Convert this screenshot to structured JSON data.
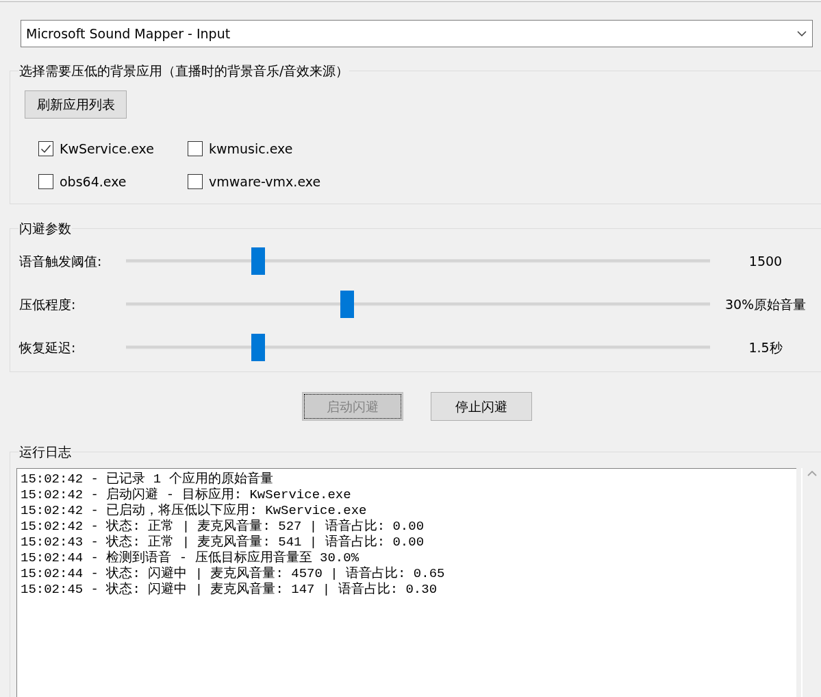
{
  "device_dropdown": {
    "value": "Microsoft Sound Mapper - Input"
  },
  "app_group": {
    "title": "选择需要压低的背景应用（直播时的背景音乐/音效来源）",
    "refresh_button": "刷新应用列表",
    "apps": [
      {
        "label": "KwService.exe",
        "checked": true
      },
      {
        "label": "kwmusic.exe",
        "checked": false
      },
      {
        "label": "obs64.exe",
        "checked": false
      },
      {
        "label": "vmware-vmx.exe",
        "checked": false
      }
    ]
  },
  "ducking_group": {
    "title": "闪避参数",
    "sliders": [
      {
        "label": "语音触发阈值:",
        "level": 0.22,
        "reading": "1500"
      },
      {
        "label": "压低程度:",
        "level": 0.376,
        "reading": "30%原始音量"
      },
      {
        "label": "恢复延迟:",
        "level": 0.22,
        "reading": "1.5秒"
      }
    ]
  },
  "buttons": [
    {
      "label": "启动闪避",
      "disabled": true,
      "focused": true
    },
    {
      "label": "停止闪避",
      "disabled": false,
      "focused": false
    }
  ],
  "log_group": {
    "title": "运行日志",
    "lines": [
      "15:02:42 - 已记录 1 个应用的原始音量",
      "15:02:42 - 启动闪避 - 目标应用: KwService.exe",
      "15:02:42 - 已启动，将压低以下应用: KwService.exe",
      "15:02:42 - 状态: 正常 | 麦克风音量: 527 | 语音占比: 0.00",
      "15:02:43 - 状态: 正常 | 麦克风音量: 541 | 语音占比: 0.00",
      "15:02:44 - 检测到语音 - 压低目标应用音量至 30.0%",
      "15:02:44 - 状态: 闪避中 | 麦克风音量: 4570 | 语音占比: 0.65",
      "15:02:45 - 状态: 闪避中 | 麦克风音量: 147 | 语音占比: 0.30"
    ]
  }
}
